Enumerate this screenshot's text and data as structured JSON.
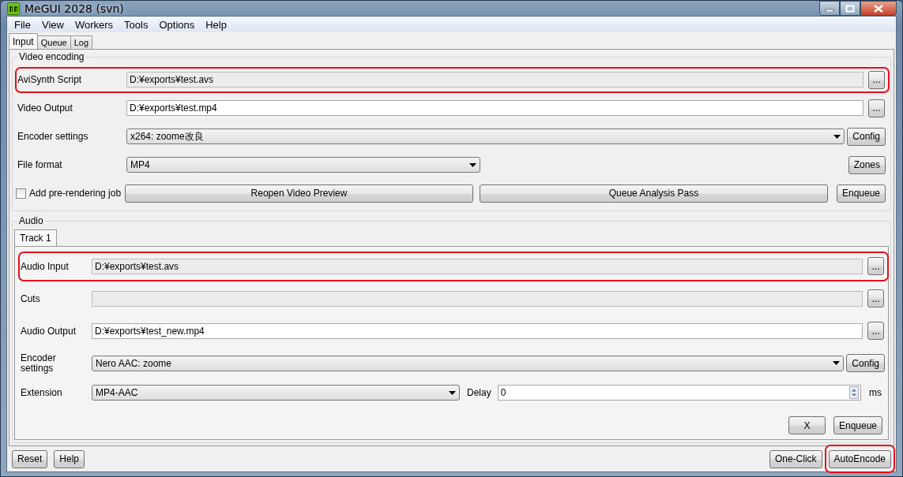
{
  "window": {
    "title": "MeGUI 2028 (svn)"
  },
  "menu": [
    "File",
    "View",
    "Workers",
    "Tools",
    "Options",
    "Help"
  ],
  "tabs": [
    {
      "label": "Input",
      "selected": true
    },
    {
      "label": "Queue",
      "selected": false
    },
    {
      "label": "Log",
      "selected": false
    }
  ],
  "video": {
    "legend": "Video encoding",
    "rows": [
      {
        "kind": "file",
        "label": "AviSynth Script",
        "value": "D:¥exports¥test.avs",
        "readonly": true,
        "highlighted": true,
        "button": "..."
      },
      {
        "kind": "file",
        "label": "Video Output",
        "value": "D:¥exports¥test.mp4",
        "readonly": false,
        "highlighted": false,
        "button": "..."
      },
      {
        "kind": "combo",
        "label": "Encoder settings",
        "value": "x264: zoome改良",
        "wide": true,
        "button": "Config"
      },
      {
        "kind": "combo",
        "label": "File format",
        "value": "MP4",
        "wide": false,
        "button": "Zones"
      },
      {
        "kind": "actions",
        "checkbox": {
          "label": "Add pre-rendering job",
          "checked": false
        },
        "buttons": [
          "Reopen Video Preview",
          "Queue Analysis Pass",
          "Enqueue"
        ]
      }
    ]
  },
  "audio": {
    "legend": "Audio",
    "tabs": [
      {
        "label": "Track 1",
        "selected": true
      }
    ],
    "rows": [
      {
        "kind": "file",
        "label": "Audio Input",
        "value": "D:¥exports¥test.avs",
        "readonly": true,
        "highlighted": true,
        "button": "..."
      },
      {
        "kind": "file",
        "label": "Cuts",
        "readonly": true,
        "highlighted": false,
        "button": "..."
      },
      {
        "kind": "file",
        "label": "Audio Output",
        "value": "D:¥exports¥test_new.mp4",
        "readonly": false,
        "highlighted": false,
        "button": "..."
      },
      {
        "kind": "combo",
        "label": "Encoder settings",
        "value": "Nero AAC: zoome",
        "wide": true,
        "button": "Config"
      },
      {
        "kind": "extension",
        "label": "Extension",
        "value": "MP4-AAC",
        "delay_label": "Delay",
        "delay": "0",
        "unit": "ms"
      }
    ],
    "buttons": [
      "X",
      "Enqueue"
    ]
  },
  "footer": {
    "left": [
      {
        "label": "Reset",
        "highlighted": false
      },
      {
        "label": "Help",
        "highlighted": false
      }
    ],
    "right": [
      {
        "label": "One-Click",
        "highlighted": false
      },
      {
        "label": "AutoEncode",
        "highlighted": true
      }
    ]
  }
}
